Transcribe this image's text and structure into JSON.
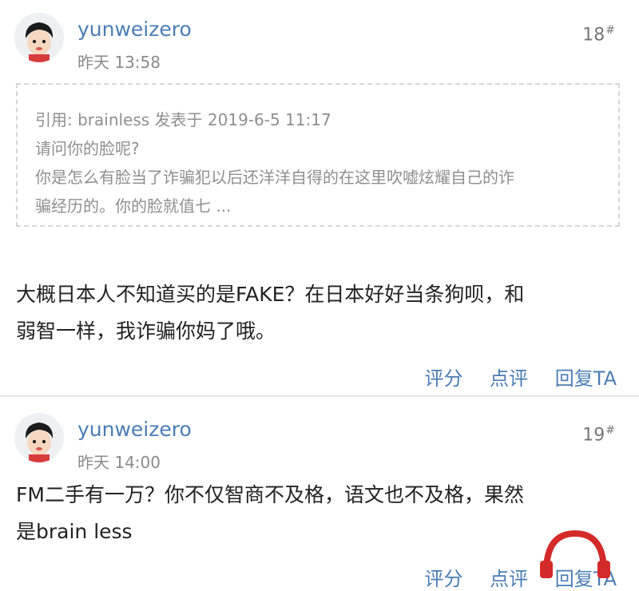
{
  "posts": [
    {
      "username": "yunweizero",
      "time": "昨天 13:58",
      "floor_number": "18",
      "floor_mark": "#",
      "quote": {
        "header": "引用: brainless 发表于 2019-6-5 11:17",
        "lines": [
          "请问你的脸呢?",
          "你是怎么有脸当了诈骗犯以后还洋洋自得的在这里吹嘘炫耀自己的诈",
          "骗经历的。你的脸就值七 ..."
        ]
      },
      "body_lines": [
        "大概日本人不知道买的是FAKE？在日本好好当条狗呗，和",
        "弱智一样，我诈骗你妈了哦。"
      ],
      "actions": {
        "rate": "评分",
        "comment": "点评",
        "reply": "回复TA"
      }
    },
    {
      "username": "yunweizero",
      "time": "昨天 14:00",
      "floor_number": "19",
      "floor_mark": "#",
      "body_lines": [
        "FM二手有一万？你不仅智商不及格，语文也不及格，果然",
        "是brain less"
      ],
      "actions": {
        "rate": "评分",
        "comment": "点评",
        "reply": "回复TA"
      }
    }
  ],
  "colors": {
    "link": "#4a7db5",
    "meta": "#8a8a8a",
    "quote_border": "#d6d6d6",
    "watermark": "#d42a2a"
  },
  "icons": {
    "avatar": "cartoon-boy-avatar-icon",
    "watermark": "headphones-logo-icon"
  }
}
